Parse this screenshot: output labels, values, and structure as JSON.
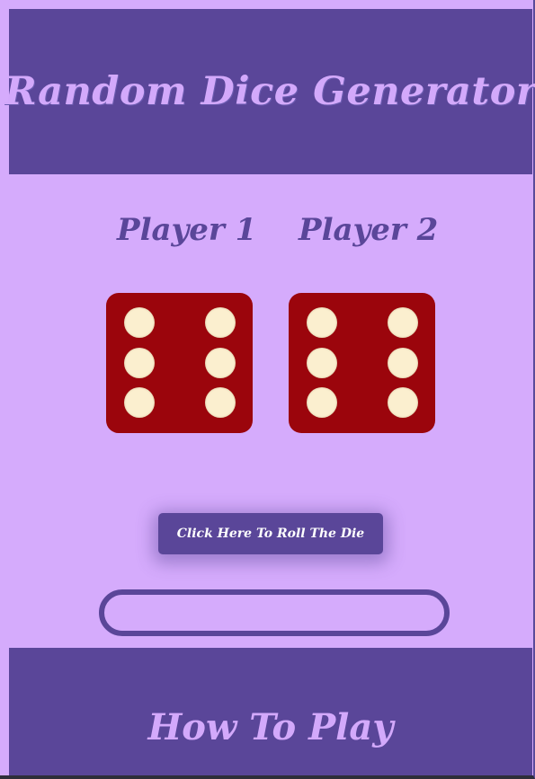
{
  "header": {
    "title": "Random Dice Generator"
  },
  "players": [
    {
      "label": "Player 1",
      "die_value": 6
    },
    {
      "label": "Player 2",
      "die_value": 6
    }
  ],
  "roll_button": {
    "label": "Click Here To Roll The Die"
  },
  "result_field": {
    "value": ""
  },
  "footer": {
    "title": "How To Play"
  },
  "colors": {
    "background": "#d5abfc",
    "accent": "#5a4699",
    "die": "#9b050c",
    "pip": "#fbefcf"
  }
}
